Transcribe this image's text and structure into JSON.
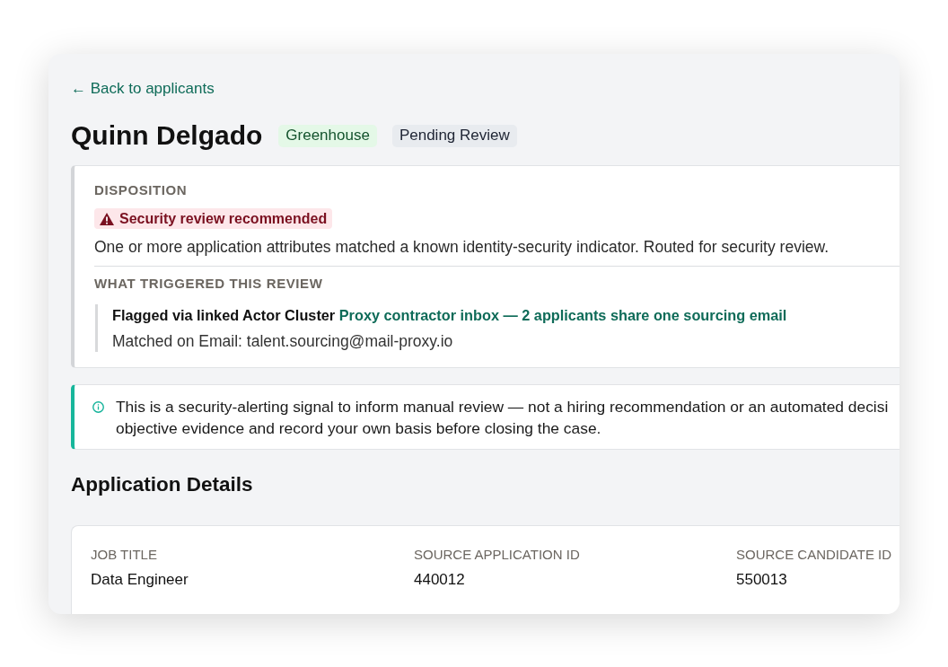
{
  "back_link": {
    "label": "← Back to applicants"
  },
  "applicant": {
    "name": "Quinn Delgado",
    "badges": [
      {
        "label": "Greenhouse",
        "kind": "source"
      },
      {
        "label": "Pending Review",
        "kind": "status"
      }
    ]
  },
  "disposition": {
    "heading": "DISPOSITION",
    "verdict": {
      "label": "Security review recommended",
      "kind": "warning"
    },
    "description": "One or more application attributes matched a known identity-security indicator. Routed for security review.",
    "trigger_heading": "WHAT TRIGGERED THIS REVIEW",
    "trigger": {
      "prefix": "Flagged via linked Actor Cluster",
      "link": "Proxy contractor inbox — 2 applicants share one sourcing email",
      "match": "Matched on Email: talent.sourcing@mail-proxy.io"
    }
  },
  "notice": {
    "kind": "info",
    "lines": [
      "This is a security-alerting signal to inform manual review — not a hiring recommendation or an automated decisi",
      "objective evidence and record your own basis before closing the case."
    ]
  },
  "details": {
    "title": "Application Details",
    "fields": [
      {
        "label": "JOB TITLE",
        "value": "Data Engineer"
      },
      {
        "label": "SOURCE APPLICATION ID",
        "value": "440012"
      },
      {
        "label": "SOURCE CANDIDATE ID",
        "value": "550013"
      }
    ]
  }
}
